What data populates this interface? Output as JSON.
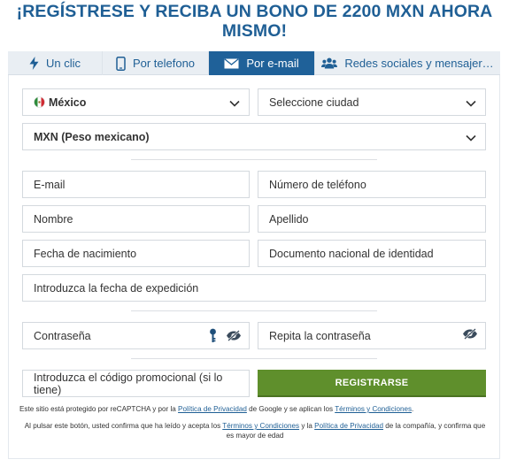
{
  "title": "¡REGÍSTRESE Y RECIBA UN BONO DE 2200 MXN AHORA MISMO!",
  "tabs": [
    {
      "label": "Un clic",
      "icon": "lightning-icon",
      "active": false
    },
    {
      "label": "Por telefono",
      "icon": "phone-icon",
      "active": false
    },
    {
      "label": "Por e-mail",
      "icon": "envelope-icon",
      "active": true
    },
    {
      "label": "Redes sociales y mensajer…",
      "icon": "people-icon",
      "active": false
    }
  ],
  "form": {
    "country": "México",
    "city_placeholder": "Seleccione ciudad",
    "currency": "MXN (Peso mexicano)",
    "email_placeholder": "E-mail",
    "phone_placeholder": "Número de teléfono",
    "first_name_placeholder": "Nombre",
    "last_name_placeholder": "Apellido",
    "birth_date_placeholder": "Fecha de nacimiento",
    "national_id_placeholder": "Documento nacional de identidad",
    "issue_date_placeholder": "Introduzca la fecha de expedición",
    "password_placeholder": "Contraseña",
    "repeat_password_placeholder": "Repita la contraseña",
    "promo_placeholder": "Introduzca el código promocional (si lo tiene)",
    "register_label": "REGISTRARSE"
  },
  "notices": {
    "recaptcha_pre": "Este sitio está protegido por reCAPTCHA y por la ",
    "privacy_link": "Política de Privacidad",
    "recaptcha_mid": " de Google y se aplican los ",
    "terms_link": "Términos y Condiciones",
    "recaptcha_end": ".",
    "confirm_pre": "Al pulsar este botón, usted confirma que ha leído y acepta los ",
    "confirm_terms_link": "Términos y Condiciones",
    "confirm_mid": " y la ",
    "confirm_privacy_link": "Política de Privacidad",
    "confirm_end": " de la compañía, y confirma que es mayor de edad"
  },
  "colors": {
    "brand_blue": "#1f6199",
    "register_green": "#5f8f2c"
  }
}
